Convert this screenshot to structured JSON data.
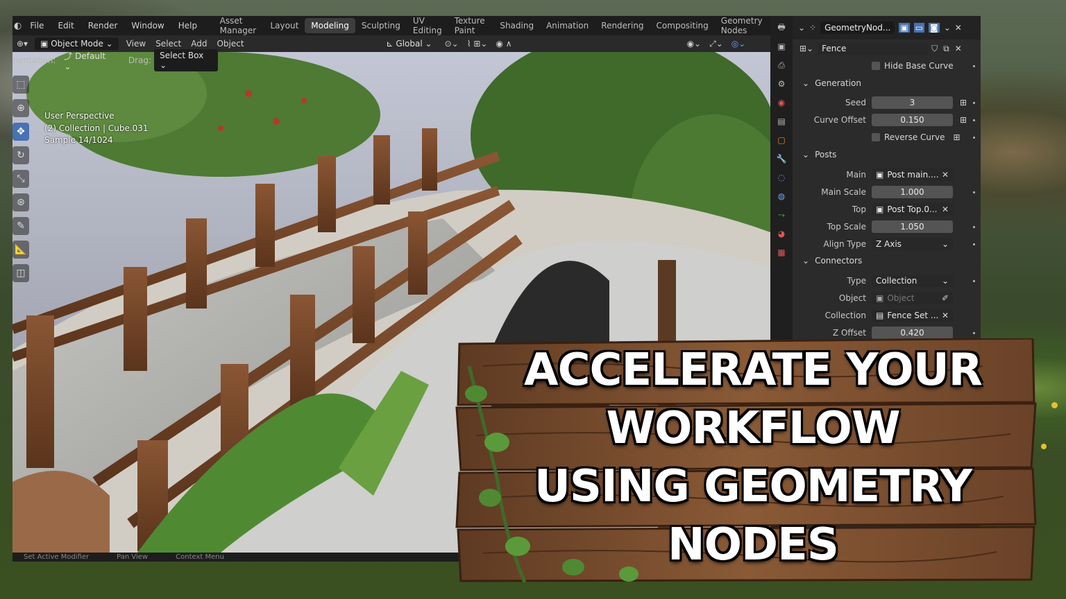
{
  "menu": {
    "items": [
      "File",
      "Edit",
      "Render",
      "Window",
      "Help"
    ]
  },
  "workspaces": {
    "tabs": [
      "Asset Manager",
      "Layout",
      "Modeling",
      "Sculpting",
      "UV Editing",
      "Texture Paint",
      "Shading",
      "Animation",
      "Rendering",
      "Compositing",
      "Geometry Nodes"
    ],
    "active": "Modeling"
  },
  "viewport_header": {
    "mode": "Object Mode",
    "menus": [
      "View",
      "Select",
      "Add",
      "Object"
    ],
    "orientation": "Global"
  },
  "tool_settings": {
    "orientation_label": "rientation:",
    "orientation_value": "Default",
    "drag_label": "Drag:",
    "drag_value": "Select Box"
  },
  "overlay": {
    "line1": "User Perspective",
    "line2": "(2) Collection | Cube.031",
    "line3": "Sample 14/1024"
  },
  "status": {
    "left": "Set Active Modifier",
    "mid": "Pan View",
    "right": "Context Menu"
  },
  "properties": {
    "modifier_name": "GeometryNod...",
    "object_name": "Fence",
    "hide_base_curve": "Hide Base Curve",
    "generation": {
      "title": "Generation",
      "seed_label": "Seed",
      "seed": "3",
      "curve_offset_label": "Curve Offset",
      "curve_offset": "0.150",
      "reverse_curve": "Reverse Curve"
    },
    "posts": {
      "title": "Posts",
      "main_label": "Main",
      "main": "Post main....",
      "main_scale_label": "Main Scale",
      "main_scale": "1.000",
      "top_label": "Top",
      "top": "Post Top.0...",
      "top_scale_label": "Top Scale",
      "top_scale": "1.050",
      "align_type_label": "Align Type",
      "align_type": "Z Axis"
    },
    "connectors": {
      "title": "Connectors",
      "type_label": "Type",
      "type": "Collection",
      "object_label": "Object",
      "object_placeholder": "Object",
      "collection_label": "Collection",
      "collection": "Fence Set ...",
      "z_offset_label": "Z Offset",
      "z_offset": "0.420"
    }
  },
  "headline": {
    "line1": "ACCELERATE YOUR",
    "line2": "WORKFLOW",
    "line3": "USING GEOMETRY",
    "line4": "NODES"
  },
  "colors": {
    "accent": "#4772b3",
    "wood": "#7a4a2a",
    "panel": "#2b2b2b"
  }
}
